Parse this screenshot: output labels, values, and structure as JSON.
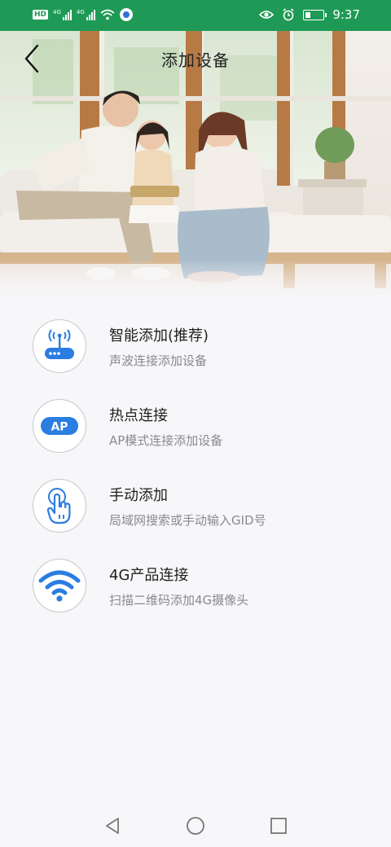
{
  "status_bar": {
    "hd_label": "HD",
    "sim1_label": "4G",
    "sim2_label": "4G",
    "time": "9:37",
    "icons": [
      "hd-icon",
      "signal-icon",
      "signal-icon",
      "wifi-icon",
      "app-notification-icon",
      "eye-icon",
      "alarm-icon",
      "battery-icon"
    ]
  },
  "header": {
    "title": "添加设备",
    "back_icon": "chevron-left-icon"
  },
  "options": [
    {
      "title": "智能添加(推荐)",
      "subtitle": "声波连接添加设备",
      "icon": "router-wave-icon"
    },
    {
      "title": "热点连接",
      "subtitle": "AP模式连接添加设备",
      "icon": "ap-icon",
      "icon_text": "AP"
    },
    {
      "title": "手动添加",
      "subtitle": "局域网搜索或手动输入GID号",
      "icon": "hand-tap-icon"
    },
    {
      "title": "4G产品连接",
      "subtitle": "扫描二维码添加4G摄像头",
      "icon": "wifi-icon"
    }
  ],
  "nav_bar": {
    "icons": [
      "back-triangle-icon",
      "home-circle-icon",
      "recents-square-icon"
    ]
  },
  "colors": {
    "status_bar": "#1f9a56",
    "accent": "#2a7de1",
    "background": "#f7f6f9"
  }
}
